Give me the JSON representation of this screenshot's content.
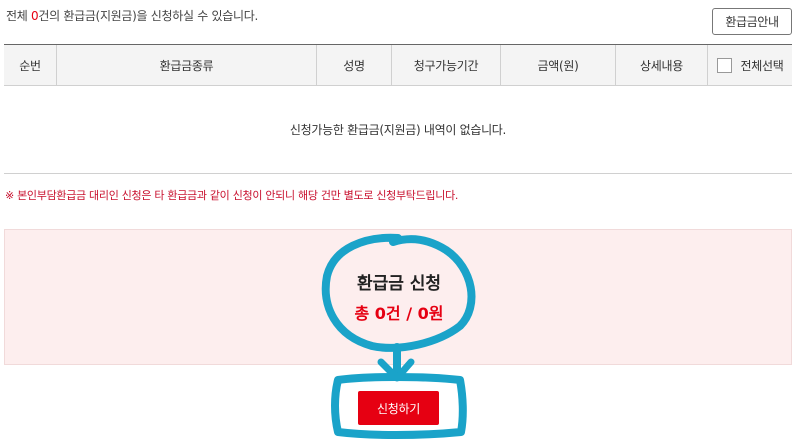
{
  "summary": {
    "prefix": "전체 ",
    "count": "0",
    "suffix": "건의 환급금(지원금)을 신청하실 수 있습니다."
  },
  "guide_button_label": "환급금안내",
  "table": {
    "columns": [
      "순번",
      "환급금종류",
      "성명",
      "청구가능기간",
      "금액(원)",
      "상세내용",
      "전체선택"
    ],
    "empty_message": "신청가능한 환급금(지원금) 내역이 없습니다."
  },
  "notice": "※ 본인부담환급금 대리인 신청은 타 환급금과 같이 신청이 안되니 해당 건만 별도로 신청부탁드립니다.",
  "apply": {
    "title": "환급금 신청",
    "total": "총 0건 / 0원",
    "button_label": "신청하기"
  },
  "colors": {
    "accent": "#e60012",
    "apply_background": "#fdeeee",
    "annotation": "#1aa3c9"
  }
}
